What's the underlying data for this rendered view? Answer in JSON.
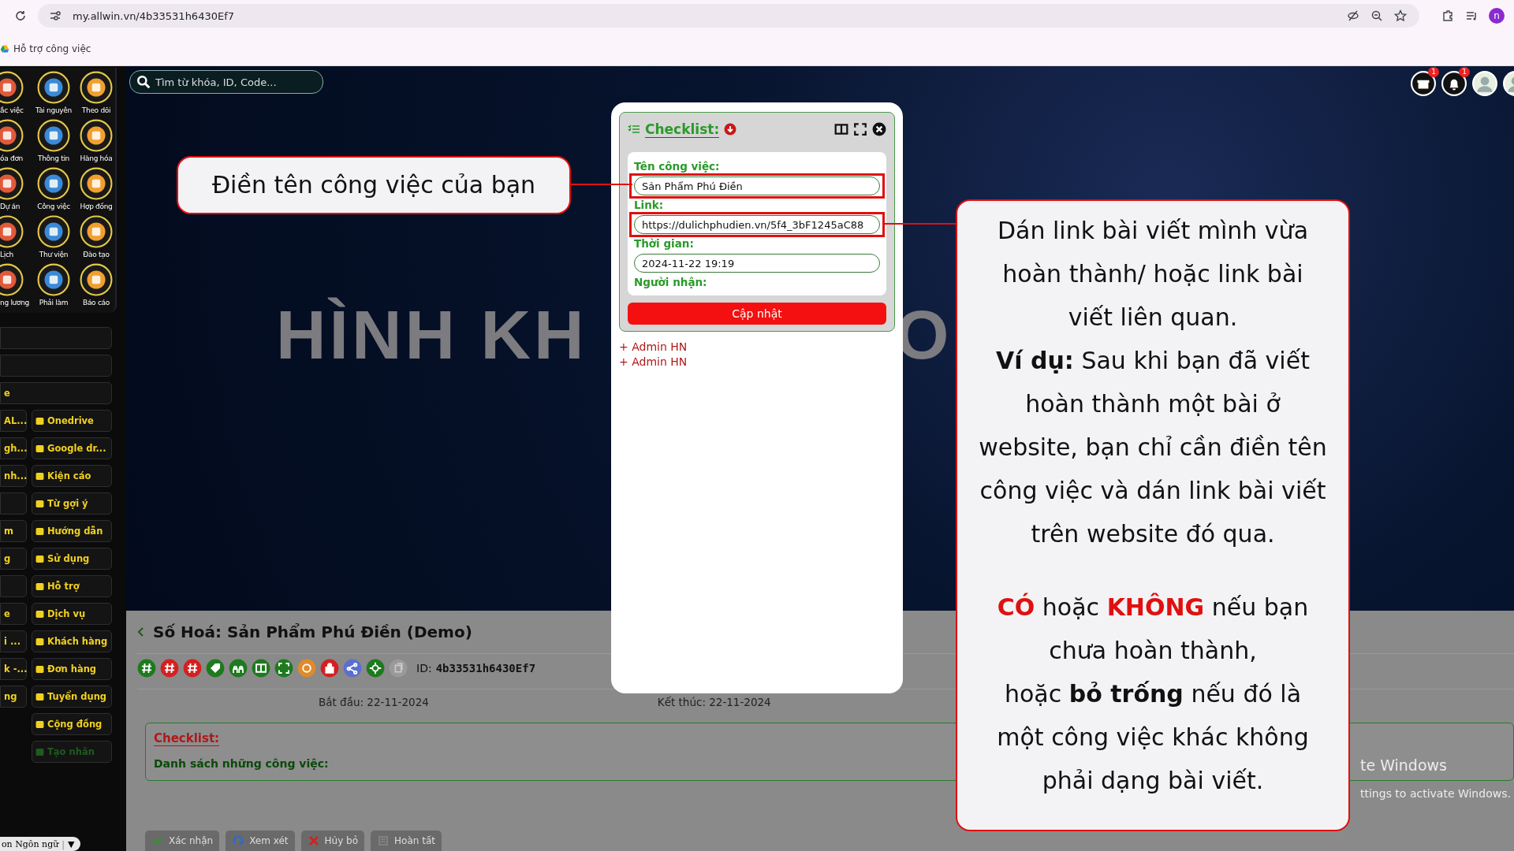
{
  "browser": {
    "url": "my.allwin.vn/4b33531h6430Ef7",
    "profile_initial": "n",
    "bookmarks": [
      "Hỗ trợ công việc"
    ]
  },
  "search": {
    "placeholder": "Tìm từ khóa, ID, Code..."
  },
  "header_icons": [
    {
      "kind": "store",
      "count": "1"
    },
    {
      "kind": "bell",
      "count": "1"
    },
    {
      "kind": "avatar"
    },
    {
      "kind": "avatar"
    }
  ],
  "sidebar": {
    "apps": [
      {
        "label": "ắc việc"
      },
      {
        "label": "Tài nguyên"
      },
      {
        "label": "Theo dõi"
      },
      {
        "label": "óa đơn"
      },
      {
        "label": "Thông tin"
      },
      {
        "label": "Hàng hóa"
      },
      {
        "label": "Dự án"
      },
      {
        "label": "Công việc"
      },
      {
        "label": "Hợp đồng"
      },
      {
        "label": "Lịch"
      },
      {
        "label": "Thư viện"
      },
      {
        "label": "Đào tạo"
      },
      {
        "label": "ng lương"
      },
      {
        "label": "Phải làm"
      },
      {
        "label": "Báo cáo"
      }
    ],
    "menu": [
      {
        "kind": "wide"
      },
      {
        "kind": "wide"
      },
      {
        "kind": "wide",
        "label": "e"
      },
      {
        "kind": "pair",
        "left": "AL...",
        "right": "Onedrive",
        "disabled": false
      },
      {
        "kind": "pair",
        "left": "gh...",
        "right": "Google dr...",
        "disabled": false
      },
      {
        "kind": "pair",
        "left": "nh...",
        "right": "Kiện cáo",
        "disabled": false
      },
      {
        "kind": "pair",
        "right": "Từ gợi ý",
        "disabled": false
      },
      {
        "kind": "pair",
        "left": "m",
        "right": "Hướng dẫn",
        "disabled": false
      },
      {
        "kind": "pair",
        "left": "g",
        "right": "Sử dụng",
        "disabled": false
      },
      {
        "kind": "pair",
        "right": "Hỗ trợ",
        "disabled": false
      },
      {
        "kind": "pair",
        "left": "e",
        "right": "Dịch vụ",
        "disabled": false
      },
      {
        "kind": "pair",
        "left": "i ...",
        "right": "Khách hàng",
        "disabled": false
      },
      {
        "kind": "pair",
        "left": "k -...",
        "right": "Đơn hàng",
        "disabled": false
      },
      {
        "kind": "pair",
        "left": "ng",
        "right": "Tuyển dụng",
        "disabled": false
      },
      {
        "kind": "single",
        "right": "Cộng đồng",
        "disabled": false
      },
      {
        "kind": "single",
        "right": "Tạo nhãn",
        "disabled": true
      }
    ],
    "language": {
      "label": "on Ngôn ngữ",
      "separator": "|",
      "caret": "▼"
    }
  },
  "banner": {
    "title_parts": [
      "HÌNH KH",
      "O"
    ]
  },
  "modal": {
    "title": "Checklist:",
    "fields": [
      {
        "label": "Tên công việc:",
        "value": "Sản Phẩm Phú Điền",
        "highlighted": true
      },
      {
        "label": "Link:",
        "value": "https://dulichphudien.vn/5f4_3bF1245aC88",
        "highlighted": true
      },
      {
        "label": "Thời gian:",
        "value": "2024-11-22 19:19",
        "highlighted": false
      },
      {
        "label": "Người nhận:"
      }
    ],
    "button": "Cập nhật",
    "recipients": [
      "+ Admin HN",
      "+ Admin HN"
    ]
  },
  "task": {
    "title": "Số Hoá: Sản Phẩm Phú Điền (Demo)",
    "toolbar": [
      {
        "kind": "hash",
        "color": "#1e7a1e"
      },
      {
        "kind": "hash",
        "color": "#d42020"
      },
      {
        "kind": "hash",
        "color": "#d42020"
      },
      {
        "kind": "tag",
        "color": "#1e7a1e"
      },
      {
        "kind": "people",
        "color": "#1e7a1e"
      },
      {
        "kind": "columns",
        "color": "#1e7a1e"
      },
      {
        "kind": "expand",
        "color": "#1e7a1e"
      },
      {
        "kind": "ring",
        "color": "#e08a2a"
      },
      {
        "kind": "lock",
        "color": "#d42020"
      },
      {
        "kind": "share",
        "color": "#5a6fd0"
      },
      {
        "kind": "target",
        "color": "#1e7a1e"
      },
      {
        "kind": "copy",
        "color": "#9a9a9a"
      }
    ],
    "id_label": "ID:",
    "id": "4b33531h6430Ef7",
    "start": "Bắt đầu: 22-11-2024",
    "end": "Kết thúc: 22-11-2024",
    "checklist": {
      "title": "Checklist:",
      "subtitle": "Danh sách những công việc:"
    },
    "actions": [
      {
        "kind": "check",
        "label": "Xác nhận"
      },
      {
        "kind": "review",
        "label": "Xem xét"
      },
      {
        "kind": "cross",
        "label": "Hủy bỏ"
      },
      {
        "kind": "done",
        "label": "Hoàn tất"
      }
    ]
  },
  "callouts": [
    {
      "paragraphs": [
        "Điền tên công việc của bạn"
      ]
    },
    {
      "paragraphs": [
        "Dán link bài viết mình vừa hoàn thành/ hoặc link bài viết liên quan.",
        "**Ví dụ:** Sau khi bạn đã viết hoàn thành một bài ở website, bạn chỉ cần điền tên công việc và dán link bài viết trên website đó qua.",
        "*CÓ* hoặc *KHÔNG* nếu bạn chưa hoàn thành,",
        "hoặc **bỏ trống** nếu đó là một công việc khác không phải dạng bài viết."
      ]
    }
  ],
  "os_watermark": [
    "te Windows",
    "ttings to activate Windows."
  ]
}
